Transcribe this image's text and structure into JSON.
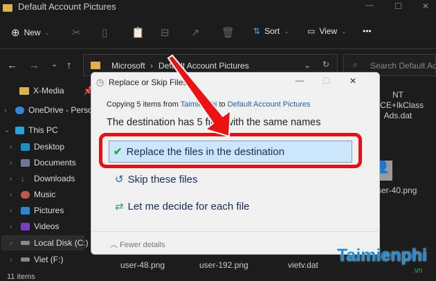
{
  "window": {
    "title": "Default Account Pictures",
    "minimize": "—",
    "maximize": "☐",
    "close": "✕"
  },
  "toolbar": {
    "new": "New",
    "sort": "Sort",
    "view": "View",
    "more": "•••"
  },
  "address": {
    "crumb1": "Microsoft",
    "sep": "›",
    "crumb2": "Default Account Pictures",
    "search_placeholder": "Search Default Acc..."
  },
  "sidebar": {
    "items": [
      {
        "label": "X-Media"
      },
      {
        "label": "OneDrive - Person"
      },
      {
        "label": "This PC"
      },
      {
        "label": "Desktop"
      },
      {
        "label": "Documents"
      },
      {
        "label": "Downloads"
      },
      {
        "label": "Music"
      },
      {
        "label": "Pictures"
      },
      {
        "label": "Videos"
      },
      {
        "label": "Local Disk (C:)"
      },
      {
        "label": "Viet (F:)"
      }
    ]
  },
  "files": {
    "nt_line1": "NT",
    "nt_line2": "VICE+IkClass",
    "nt_line3": "Ads.dat",
    "user40": "ser-40.png",
    "user48": "user-48.png",
    "user192": "user-192.png",
    "vietv": "vietv.dat"
  },
  "status": {
    "count": "11 items"
  },
  "dialog": {
    "title": "Replace or Skip Files",
    "copy_prefix": "Copying 5 items from ",
    "source": "Taimienphi",
    "copy_to": " to ",
    "dest": "Default Account Pictures",
    "message": "The destination has 5 files with the same names",
    "replace": "Replace the files in the destination",
    "skip": "Skip these files",
    "decide": "Let me decide for each file",
    "fewer": "Fewer details"
  },
  "watermark": {
    "brand": "Taimienphi",
    "tld": ".vn"
  }
}
